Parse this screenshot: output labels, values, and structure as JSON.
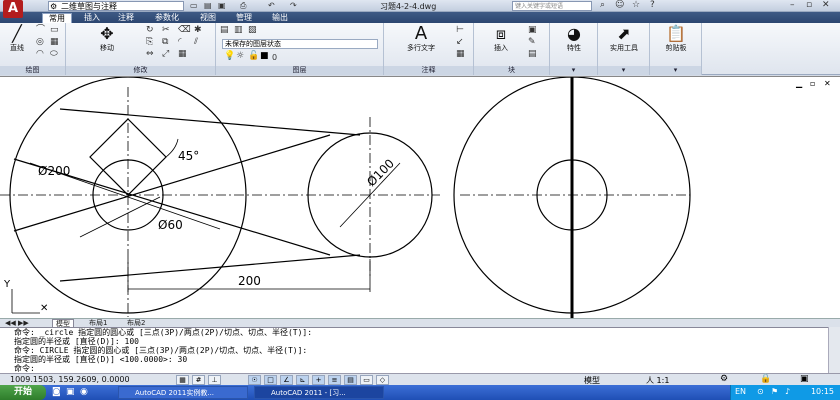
{
  "titlebar": {
    "workspace": "二维草图与注释",
    "doc_title": "习题4-2-4.dwg",
    "search_placeholder": "键入关键字或短语"
  },
  "tabs": [
    "常用",
    "插入",
    "注释",
    "参数化",
    "视图",
    "管理",
    "输出"
  ],
  "ribbon": {
    "draw": {
      "title": "绘图",
      "line_label": "直线"
    },
    "modify": {
      "title": "修改",
      "move_label": "移动"
    },
    "layers": {
      "title": "图层",
      "state": "未保存的图层状态",
      "current": "0"
    },
    "annotation": {
      "title": "注释",
      "mtext_label": "多行文字"
    },
    "block": {
      "title": "块",
      "insert_label": "插入"
    },
    "properties_label": "特性",
    "utilities_label": "实用工具",
    "clipboard_label": "剪贴板"
  },
  "drawing": {
    "dim_200_dia": "Ø200",
    "dim_45": "45°",
    "dim_60_dia": "Ø60",
    "dim_100_dia": "Ø100",
    "dim_200": "200"
  },
  "layout_tabs": [
    "模型",
    "布局1",
    "布局2"
  ],
  "command_lines": [
    "命令: _circle 指定圆的圆心或 [三点(3P)/两点(2P)/切点、切点、半径(T)]:",
    "指定圆的半径或 [直径(D)]: 100",
    "命令:  CIRCLE 指定圆的圆心或 [三点(3P)/两点(2P)/切点、切点、半径(T)]:",
    "指定圆的半径或 [直径(D)] <100.0000>: 30",
    "命令:"
  ],
  "status": {
    "coords": "1009.1503, 159.2609, 0.0000",
    "model": "模型",
    "scale": "人 1:1"
  },
  "taskbar": {
    "start": "开始",
    "task1": "AutoCAD 2011实例教...",
    "task2": "AutoCAD 2011 - [习...",
    "clock": "10:15"
  }
}
